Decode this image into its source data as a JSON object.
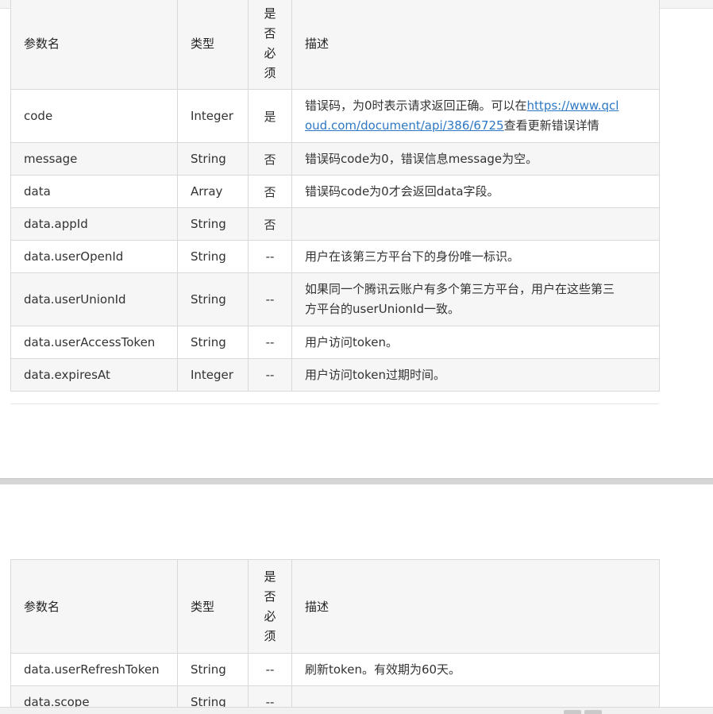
{
  "table_headers": {
    "name": "参数名",
    "type": "类型",
    "required_chars": [
      "是",
      "否",
      "必",
      "须"
    ],
    "description": "描述"
  },
  "table1": {
    "rows": [
      {
        "name": "code",
        "type": "Integer",
        "required": "是",
        "desc_before": "错误码，为0时表示请求返回正确。可以在",
        "desc_link_line1": "https://www.qcl",
        "desc_link_line2": "oud.com/document/api/386/6725",
        "desc_after": "查看更新错误详情"
      },
      {
        "name": "message",
        "type": "String",
        "required": "否",
        "desc": "错误码code为0，错误信息message为空。"
      },
      {
        "name": "data",
        "type": "Array",
        "required": "否",
        "desc": "错误码code为0才会返回data字段。"
      },
      {
        "name": "data.appId",
        "type": "String",
        "required": "否",
        "desc": ""
      },
      {
        "name": "data.userOpenId",
        "type": "String",
        "required": "--",
        "desc": "用户在该第三方平台下的身份唯一标识。"
      },
      {
        "name": "data.userUnionId",
        "type": "String",
        "required": "--",
        "desc_line1": "如果同一个腾讯云账户有多个第三方平台，用户在这些第三",
        "desc_line2": "方平台的userUnionId一致。"
      },
      {
        "name": "data.userAccessToken",
        "type": "String",
        "required": "--",
        "desc": "用户访问token。"
      },
      {
        "name": "data.expiresAt",
        "type": "Integer",
        "required": "--",
        "desc": "用户访问token过期时间。"
      }
    ]
  },
  "table2": {
    "rows": [
      {
        "name": "data.userRefreshToken",
        "type": "String",
        "required": "--",
        "desc": "刷新token。有效期为60天。"
      },
      {
        "name": "data.scope",
        "type": "String",
        "required": "--",
        "desc": ""
      }
    ]
  }
}
